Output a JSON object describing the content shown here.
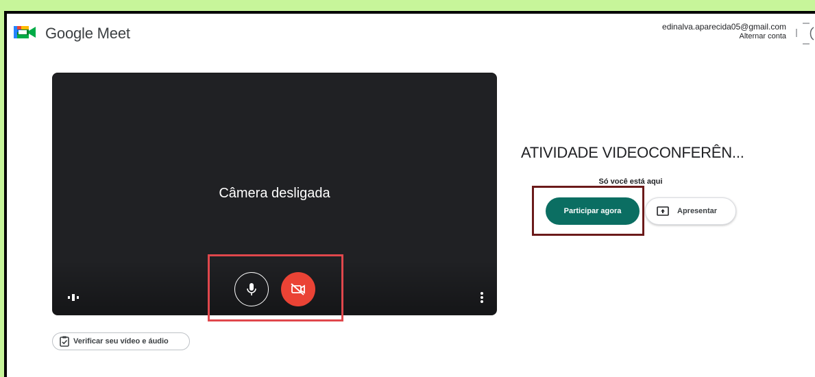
{
  "header": {
    "brand": "Google Meet",
    "account_email": "edinalva.aparecida05@gmail.com",
    "switch_account": "Alternar conta"
  },
  "preview": {
    "camera_status": "Câmera desligada",
    "mic_state": "on",
    "camera_state": "off"
  },
  "check_button": {
    "label": "Verificar seu vídeo e áudio"
  },
  "meeting": {
    "title": "ATIVIDADE VIDEOCONFERÊN...",
    "status": "Só você está aqui",
    "join_label": "Participar agora",
    "present_label": "Apresentar"
  },
  "colors": {
    "join_button": "#0b6e62",
    "camera_off_button": "#ea4335",
    "preview_bg": "#202124",
    "highlight_red": "#e0474c",
    "highlight_dark": "#6b1a1a",
    "outer_border": "#c7f59a"
  },
  "icons": [
    "google-meet-logo",
    "mic-icon",
    "camera-off-icon",
    "visual-effects-icon",
    "more-vert-icon",
    "clipboard-check-icon",
    "present-screen-icon"
  ]
}
